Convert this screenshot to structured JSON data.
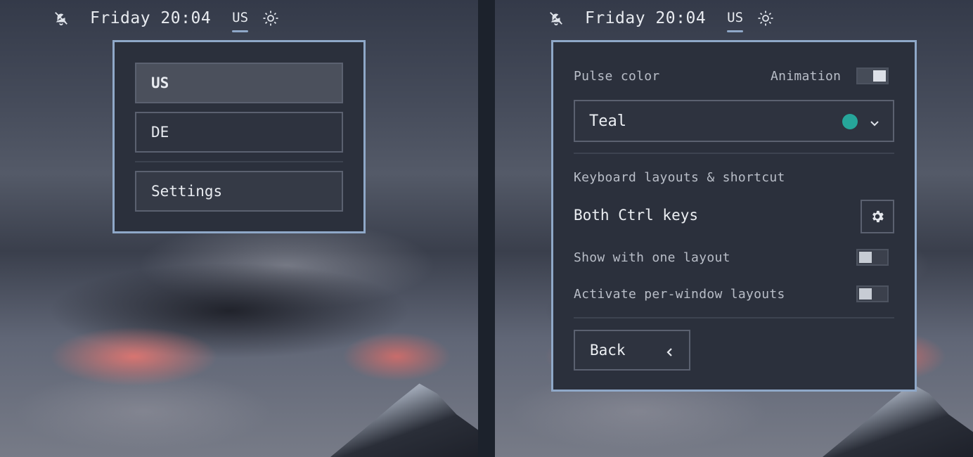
{
  "topbar": {
    "day_time": "Friday 20:04",
    "layout": "US"
  },
  "menu": {
    "items": [
      {
        "label": "US",
        "active": true
      },
      {
        "label": "DE",
        "active": false
      }
    ],
    "settings_label": "Settings"
  },
  "settings": {
    "pulse_color_label": "Pulse color",
    "animation_label": "Animation",
    "animation_on": true,
    "pulse_color_value": "Teal",
    "pulse_color_hex": "#26a69a",
    "keyboard_section_label": "Keyboard layouts & shortcut",
    "shortcut_value": "Both Ctrl keys",
    "show_one_layout_label": "Show with one layout",
    "show_one_layout_on": false,
    "per_window_label": "Activate per-window layouts",
    "per_window_on": false,
    "back_label": "Back"
  },
  "colors": {
    "accent": "#8fa8c8",
    "panel": "#2b303c"
  },
  "icons": [
    "bell-off-icon",
    "sun-icon",
    "chevron-down-icon",
    "gear-icon",
    "chevron-left-icon"
  ]
}
